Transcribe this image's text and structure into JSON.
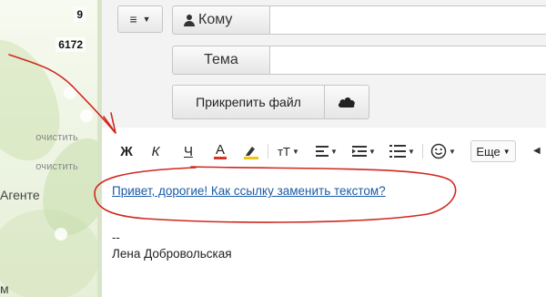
{
  "sidebar": {
    "count_1": "9",
    "count_2": "6172",
    "clear_1": "очистить",
    "clear_2": "очистить",
    "cut_text_1": "Агенте",
    "cut_text_2": "м"
  },
  "compose": {
    "menu_icon": "hamburger-icon",
    "to_label": "Кому",
    "to_value": "",
    "subject_label": "Тема",
    "subject_value": "",
    "attach_label": "Прикрепить файл",
    "cloud_icon": "cloud-icon"
  },
  "toolbar": {
    "bold": "Ж",
    "italic": "К",
    "underline": "Ч",
    "font_color": "А",
    "font_size": "тТ",
    "more": "Еще",
    "font_color_accent": "#e0301e",
    "highlight_accent": "#f1c40f"
  },
  "body": {
    "link_text": "Привет, дорогие! Как ссылку заменить текстом?",
    "sig_dash": "--",
    "sig_name": "Лена Добровольская"
  },
  "colors": {
    "link": "#1a5aa6",
    "annotation": "#d0281f"
  }
}
